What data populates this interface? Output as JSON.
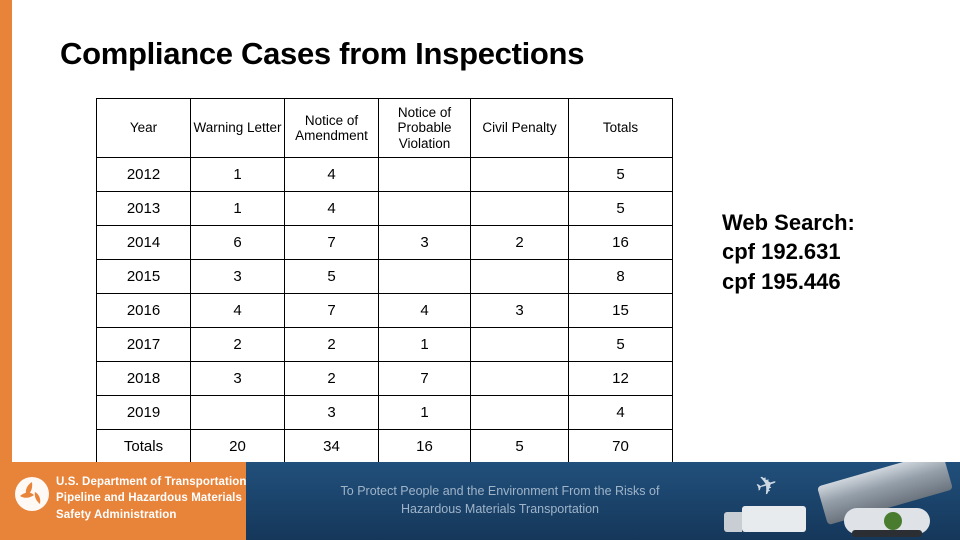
{
  "slide": {
    "title": "Compliance Cases from Inspections"
  },
  "table": {
    "headers": [
      "Year",
      "Warning Letter",
      "Notice of Amendment",
      "Notice of Probable Violation",
      "Civil Penalty",
      "Totals"
    ],
    "rows": [
      {
        "year": "2012",
        "warning_letter": "1",
        "notice_of_amendment": "4",
        "notice_of_probable_violation": "",
        "civil_penalty": "",
        "totals": "5"
      },
      {
        "year": "2013",
        "warning_letter": "1",
        "notice_of_amendment": "4",
        "notice_of_probable_violation": "",
        "civil_penalty": "",
        "totals": "5"
      },
      {
        "year": "2014",
        "warning_letter": "6",
        "notice_of_amendment": "7",
        "notice_of_probable_violation": "3",
        "civil_penalty": "2",
        "totals": "16"
      },
      {
        "year": "2015",
        "warning_letter": "3",
        "notice_of_amendment": "5",
        "notice_of_probable_violation": "",
        "civil_penalty": "",
        "totals": "8"
      },
      {
        "year": "2016",
        "warning_letter": "4",
        "notice_of_amendment": "7",
        "notice_of_probable_violation": "4",
        "civil_penalty": "3",
        "totals": "15"
      },
      {
        "year": "2017",
        "warning_letter": "2",
        "notice_of_amendment": "2",
        "notice_of_probable_violation": "1",
        "civil_penalty": "",
        "totals": "5"
      },
      {
        "year": "2018",
        "warning_letter": "3",
        "notice_of_amendment": "2",
        "notice_of_probable_violation": "7",
        "civil_penalty": "",
        "totals": "12"
      },
      {
        "year": "2019",
        "warning_letter": "",
        "notice_of_amendment": "3",
        "notice_of_probable_violation": "1",
        "civil_penalty": "",
        "totals": "4"
      },
      {
        "year": "Totals",
        "warning_letter": "20",
        "notice_of_amendment": "34",
        "notice_of_probable_violation": "16",
        "civil_penalty": "5",
        "totals": "70"
      }
    ]
  },
  "notes": {
    "line1": "Web Search:",
    "line2": "cpf 192.631",
    "line3": "cpf 195.446"
  },
  "footer": {
    "agency_line1": "U.S. Department of Transportation",
    "agency_line2": "Pipeline and Hazardous Materials",
    "agency_line3": "Safety Administration",
    "tagline_line1": "To Protect People and the Environment From the Risks of",
    "tagline_line2": "Hazardous Materials Transportation"
  },
  "colors": {
    "accent_orange": "#E8833A",
    "footer_blue": "#1F4E79"
  }
}
